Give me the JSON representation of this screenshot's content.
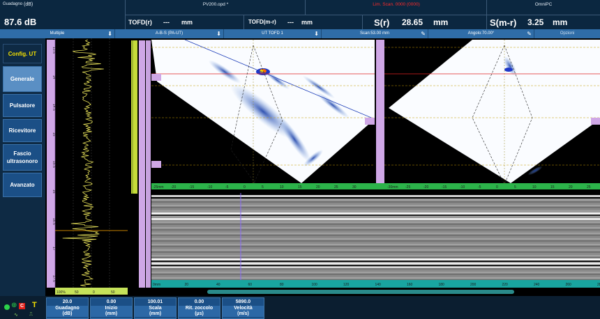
{
  "topbar": {
    "gain_small": "Guadagno",
    "gain_unit": "(dB)",
    "gain_value": "87.6 dB",
    "file_title": "PV200.opd *",
    "alert_text": "Lim. Scan. 0000 (0000)",
    "device": "OmniPC",
    "tofd_r_label": "TOFD(r)",
    "tofd_r_value": "---",
    "tofd_r_unit": "mm",
    "tofd_mr_label": "TOFD(m-r)",
    "tofd_mr_value": "---",
    "tofd_mr_unit": "mm",
    "s_r_label": "S(r)",
    "s_r_value": "28.65",
    "s_r_unit": "mm",
    "s_mr_label": "S(m-r)",
    "s_mr_value": "3.25",
    "s_mr_unit": "mm"
  },
  "toolbar": {
    "multiple": "Multiple",
    "layout": "A-B-S (PA-UT)",
    "group": "UT TOFD 1",
    "scan": "Scan:53.00 mm",
    "angle": "Angolo:70.00°",
    "options": "Opzioni"
  },
  "menu": {
    "config": "Config. UT",
    "items": [
      "Generale",
      "Pulsatore",
      "Ricevitore",
      "Fascio ultrasonoro",
      "Avanzato"
    ]
  },
  "params": [
    {
      "value": "20.0",
      "label1": "Guadagno",
      "label2": "(dB)"
    },
    {
      "value": "0.00",
      "label1": "Inizio",
      "label2": "(mm)"
    },
    {
      "value": "100.01",
      "label1": "Scala",
      "label2": "(mm)"
    },
    {
      "value": "0.00",
      "label1": "Rit. zoccolo",
      "label2": "(µs)"
    },
    {
      "value": "5890.0",
      "label1": "Velocità",
      "label2": "(m/s)"
    }
  ],
  "scan_labels": {
    "cl": "CL",
    "ascan_depth_ticks": [
      "13.5",
      "14",
      "14.5",
      "15",
      "15.5",
      "16",
      "16.5",
      "17",
      "17.5"
    ],
    "ascan_amp_ticks": [
      "100%",
      "50",
      "0",
      "50",
      "100"
    ],
    "sscan_x_ticks_left": [
      "-25mm",
      "-20",
      "-15",
      "-10",
      "-5",
      "0",
      "5",
      "10",
      "15",
      "20",
      "25",
      "30"
    ],
    "sscan_x_ticks_right": [
      "-30mm",
      "-25",
      "-20",
      "-15",
      "-10",
      "-5",
      "0",
      "5",
      "10",
      "15",
      "20",
      "25"
    ],
    "dscan_ticks": [
      "0mm",
      "20",
      "40",
      "60",
      "80",
      "100",
      "120",
      "140",
      "160",
      "180",
      "200",
      "220",
      "240",
      "260",
      "280"
    ]
  },
  "colors": {
    "topbar_bg": "#0b2740",
    "toolbar_bg": "#2f6da8",
    "ruler_green": "#2cb34a",
    "ruler_purple": "#b58ad6",
    "ruler_teal": "#19a5a0",
    "ruler_lime": "#c6db3a",
    "alert_red": "#ff2a2a",
    "menu_active": "#5a8fc4"
  }
}
